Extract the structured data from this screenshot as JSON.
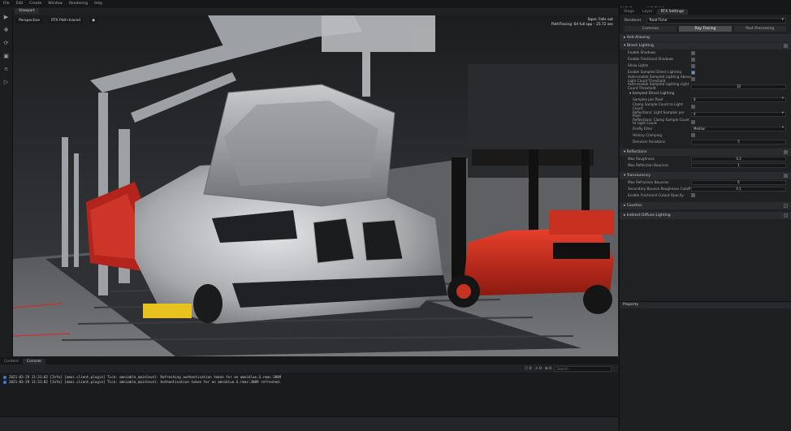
{
  "menu": {
    "items": [
      "File",
      "Edit",
      "Create",
      "Window",
      "Rendering",
      "Help"
    ],
    "right": [
      "CACHE",
      "●",
      "LIVE SYNC"
    ]
  },
  "viewport": {
    "tab": "Viewport",
    "toolbar": [
      "Perspective",
      "RTX Path-traced",
      "◉"
    ],
    "info": [
      "Sqon: Falls out",
      "PathTracing: 64 full spp – 25.72 sec"
    ]
  },
  "bottom_panel": {
    "tabs": [
      "Content",
      "Console"
    ],
    "active_tab": "Console",
    "counts": [
      "ⓘ 0",
      "⚠ 0",
      "⊗ 0"
    ],
    "search_placeholder": "Search",
    "logs": [
      "2021-03-29 11:31:82  [Info] [omni.client.plugin]  Tick: omniable_mainlevel: Refreshing authentication token for en omniblue.S.rmac:3009",
      "2021-03-29 11:31:82  [Info] [omni.client.plugin]  Tick: omniable_mainlevel: Authentication token for en omniblue.S.rmac:3009 refreshed."
    ]
  },
  "render_settings": {
    "tabs": [
      "Stage",
      "Layer",
      "RTX Settings"
    ],
    "active_tab": "RTX Settings",
    "renderer_label": "Renderer",
    "renderer_value": "Real-Time",
    "modes": [
      "Common",
      "Ray Tracing",
      "Post Processing"
    ],
    "active_mode": "Ray Tracing",
    "anti_aliasing": "Anti-Aliasing",
    "direct_lighting": {
      "title": "Direct Lighting",
      "props": [
        {
          "label": "Enable Shadows",
          "type": "check"
        },
        {
          "label": "Enable Fractional Shadows",
          "type": "check"
        },
        {
          "label": "Show Lights",
          "type": "check"
        },
        {
          "label": "Enable Sampled Direct Lighting",
          "type": "check_blue"
        },
        {
          "label": "Auto-enable Sampled Lighting Above Light Count Threshold",
          "type": "check"
        },
        {
          "label": "Auto-enable Sampled Lighting Light Count Threshold",
          "type": "field",
          "value": "10"
        }
      ],
      "sampled_title": "Sampled Direct Lighting",
      "sampled_props": [
        {
          "label": "Samples per Pixel",
          "type": "dropdown",
          "value": "8"
        },
        {
          "label": "Clamp Sample Count to Light Count",
          "type": "check"
        },
        {
          "label": "Reflections: Light Samples per Pixel",
          "type": "dropdown",
          "value": "4"
        },
        {
          "label": "Reflections: Clamp Sample Count to Light Count",
          "type": "check"
        },
        {
          "label": "Firefly Filter",
          "type": "dropdown",
          "value": "Median"
        },
        {
          "label": "History Clamping",
          "type": "check"
        },
        {
          "label": "Denoiser Iterations",
          "type": "field",
          "value": "5"
        }
      ]
    },
    "reflections": {
      "title": "Reflections",
      "props": [
        {
          "label": "Max Roughness",
          "type": "field",
          "value": "0.3"
        },
        {
          "label": "Max Reflection Bounces",
          "type": "field",
          "value": "1"
        }
      ]
    },
    "translucency": {
      "title": "Translucency",
      "props": [
        {
          "label": "Max Refraction Bounces",
          "type": "field",
          "value": "6"
        },
        {
          "label": "Secondary Bounce Roughness Cutoff",
          "type": "field",
          "value": "0.1"
        },
        {
          "label": "Enable Fractional Cutout Opacity",
          "type": "check"
        }
      ]
    },
    "caustics": "Caustics",
    "indirect": "Indirect Diffuse Lighting",
    "property_title": "Property"
  }
}
